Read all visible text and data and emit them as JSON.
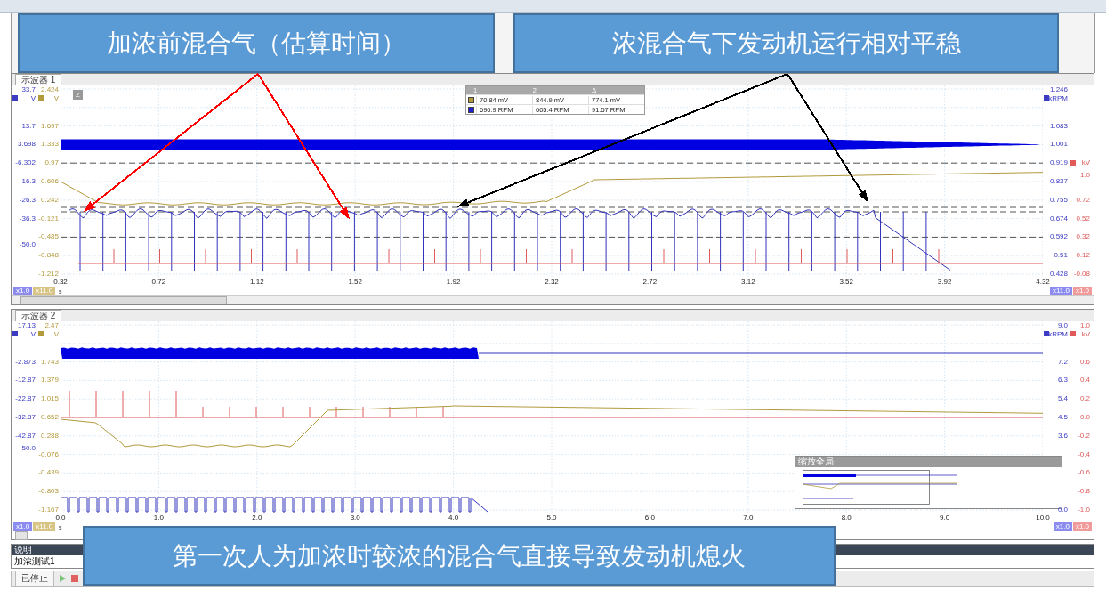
{
  "scopes": [
    {
      "title": "示波器 1",
      "kind": "scope1",
      "left_axes": [
        {
          "color": "#3b3bc4",
          "unit": "V",
          "labels": [
            "33.7",
            "13.7",
            "3.698",
            "-6.302",
            "-16.3",
            "-26.3",
            "-36.3",
            "-50.0"
          ]
        },
        {
          "color": "#b39a3c",
          "unit": "V",
          "labels": [
            "2.424",
            "1.697",
            "1.333",
            "0.97",
            "0.606",
            "0.242",
            "-0.121",
            "-0.485",
            "-0.848",
            "-1.212"
          ]
        }
      ],
      "right_axes": [
        {
          "color": "#3b3bc4",
          "unit": "kRPM",
          "labels": [
            "1.246",
            "1.083",
            "1.001",
            "0.919",
            "0.837",
            "0.755",
            "0.674",
            "0.592",
            "0.51",
            "0.428"
          ]
        },
        {
          "color": "#e05a5a",
          "labels": [
            "kV",
            "1.0",
            "0.72",
            "0.52",
            "0.32",
            "0.12",
            "-0.08"
          ]
        }
      ],
      "x_ticks": [
        "0.32",
        "0.72",
        "1.12",
        "1.52",
        "1.92",
        "2.32",
        "2.72",
        "3.12",
        "3.52",
        "3.92",
        "4.32"
      ],
      "x_unit": "s",
      "left_badges": [
        {
          "text": "x1.0",
          "color": "#8c8cf0"
        },
        {
          "text": "x11.0",
          "color": "#d8c484"
        }
      ],
      "right_badges": [
        {
          "text": "x11.0",
          "color": "#8c8cf0"
        },
        {
          "text": "x1.0",
          "color": "#f09a9a"
        }
      ],
      "zoom_widget": {
        "label": "Z"
      },
      "cursor_table": {
        "headers": [
          "1",
          "2",
          "Δ"
        ],
        "rows": [
          {
            "color": "#b39a3c",
            "cells": [
              "70.84 mV",
              "844.9 mV",
              "774.1 mV"
            ]
          },
          {
            "color": "#2020d0",
            "cells": [
              "696.9 RPM",
              "605.4 RPM",
              "91.57 RPM"
            ]
          }
        ]
      }
    },
    {
      "title": "示波器 2",
      "kind": "scope2",
      "left_axes": [
        {
          "color": "#3b3bc4",
          "unit": "V",
          "labels": [
            "17.13",
            "-2.873",
            "-12.87",
            "-22.87",
            "-32.87",
            "-42.87",
            "-50.0"
          ]
        },
        {
          "color": "#b39a3c",
          "unit": "V",
          "labels": [
            "2.47",
            "1.743",
            "1.379",
            "1.015",
            "0.652",
            "0.288",
            "-0.076",
            "-0.439",
            "-0.803",
            "-1.167"
          ]
        }
      ],
      "right_axes": [
        {
          "color": "#3b3bc4",
          "unit": "kRPM",
          "labels": [
            "9.0",
            "7.2",
            "6.3",
            "5.4",
            "4.5",
            "3.6",
            "0.0"
          ]
        },
        {
          "color": "#e05a5a",
          "unit": "kV",
          "labels": [
            "1.0",
            "0.6",
            "0.4",
            "0.2",
            "0.0",
            "-0.2",
            "-0.4",
            "-0.6",
            "-0.8",
            "-1.0"
          ]
        }
      ],
      "x_ticks": [
        "0.0",
        "1.0",
        "2.0",
        "3.0",
        "4.0",
        "5.0",
        "6.0",
        "7.0",
        "8.0",
        "9.0",
        "10.0"
      ],
      "x_unit": "s",
      "left_badges": [
        {
          "text": "x1.0",
          "color": "#8c8cf0"
        },
        {
          "text": "x11.0",
          "color": "#d8c484"
        }
      ],
      "right_badges": [
        {
          "text": "x1.0",
          "color": "#8c8cf0"
        },
        {
          "text": "x1.0",
          "color": "#f09a9a"
        }
      ],
      "overview": {
        "title": "缩放全局"
      }
    }
  ],
  "notes_panel": {
    "title": "说明",
    "text": "加浓测试1"
  },
  "status": {
    "text": "已停止"
  },
  "callouts": [
    {
      "text": "加浓前混合气（估算时间）",
      "kind": "top_left",
      "color": "#ff0000"
    },
    {
      "text": "浓混合气下发动机运行相对平稳",
      "kind": "top_right",
      "color": "#000000"
    },
    {
      "text": "第一次人为加浓时较浓的混合气直接导致发动机熄火",
      "kind": "bottom"
    }
  ]
}
